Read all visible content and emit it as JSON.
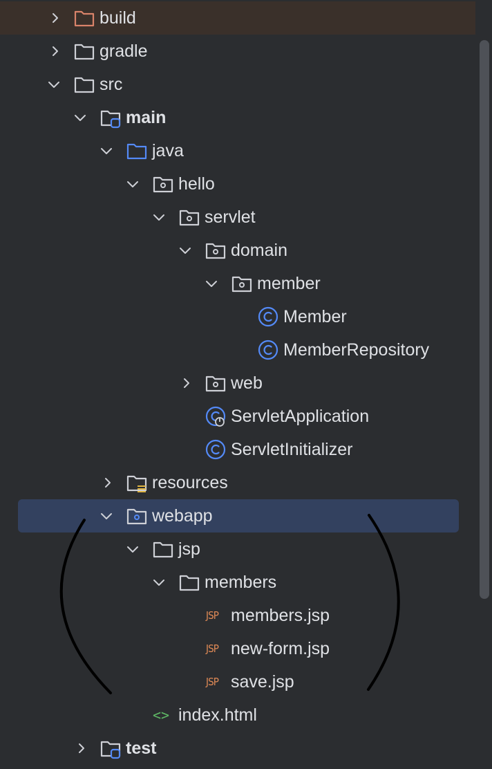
{
  "tree": {
    "items": [
      {
        "label": "build"
      },
      {
        "label": "gradle"
      },
      {
        "label": "src"
      },
      {
        "label": "main"
      },
      {
        "label": "java"
      },
      {
        "label": "hello"
      },
      {
        "label": "servlet"
      },
      {
        "label": "domain"
      },
      {
        "label": "member"
      },
      {
        "label": "Member"
      },
      {
        "label": "MemberRepository"
      },
      {
        "label": "web"
      },
      {
        "label": "ServletApplication"
      },
      {
        "label": "ServletInitializer"
      },
      {
        "label": "resources"
      },
      {
        "label": "webapp"
      },
      {
        "label": "jsp"
      },
      {
        "label": "members"
      },
      {
        "label": "members.jsp"
      },
      {
        "label": "new-form.jsp"
      },
      {
        "label": "save.jsp"
      },
      {
        "label": "index.html"
      },
      {
        "label": "test"
      }
    ],
    "jsp_icon_text": "JSP",
    "html_icon_text": "<>"
  },
  "colors": {
    "background": "#2b2d30",
    "selection": "#33415f",
    "excluded_folder": "#d9836a",
    "folder": "#ced0d6",
    "source_folder": "#548af7",
    "class_icon": "#548af7",
    "jsp_icon": "#e08a56",
    "html_icon": "#5fb865",
    "text": "#dfe1e5"
  }
}
